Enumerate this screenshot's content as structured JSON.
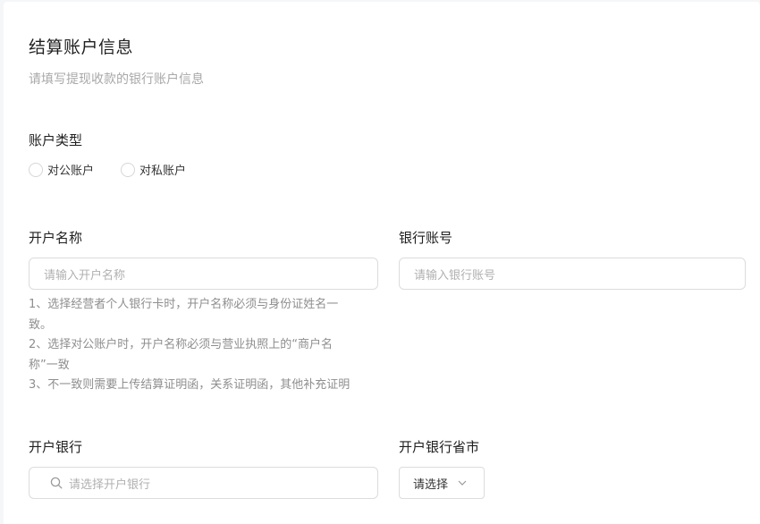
{
  "header": {
    "title": "结算账户信息",
    "subtitle": "请填写提现收款的银行账户信息"
  },
  "account_type": {
    "label": "账户类型",
    "options": [
      "对公账户",
      "对私账户"
    ]
  },
  "account_name": {
    "label": "开户名称",
    "placeholder": "请输入开户名称",
    "hints": [
      "1、选择经营者个人银行卡时，开户名称必须与身份证姓名一",
      "致。",
      "2、选择对公账户时，开户名称必须与营业执照上的“商户名",
      "称”一致",
      "3、不一致则需要上传结算证明函，关系证明函，其他补充证明"
    ]
  },
  "bank_account": {
    "label": "银行账号",
    "placeholder": "请输入银行账号"
  },
  "bank": {
    "label": "开户银行",
    "placeholder": "请选择开户银行",
    "icon": "search-icon"
  },
  "bank_region": {
    "label": "开户银行省市",
    "select_value": "请选择",
    "icon": "chevron-down-icon"
  }
}
